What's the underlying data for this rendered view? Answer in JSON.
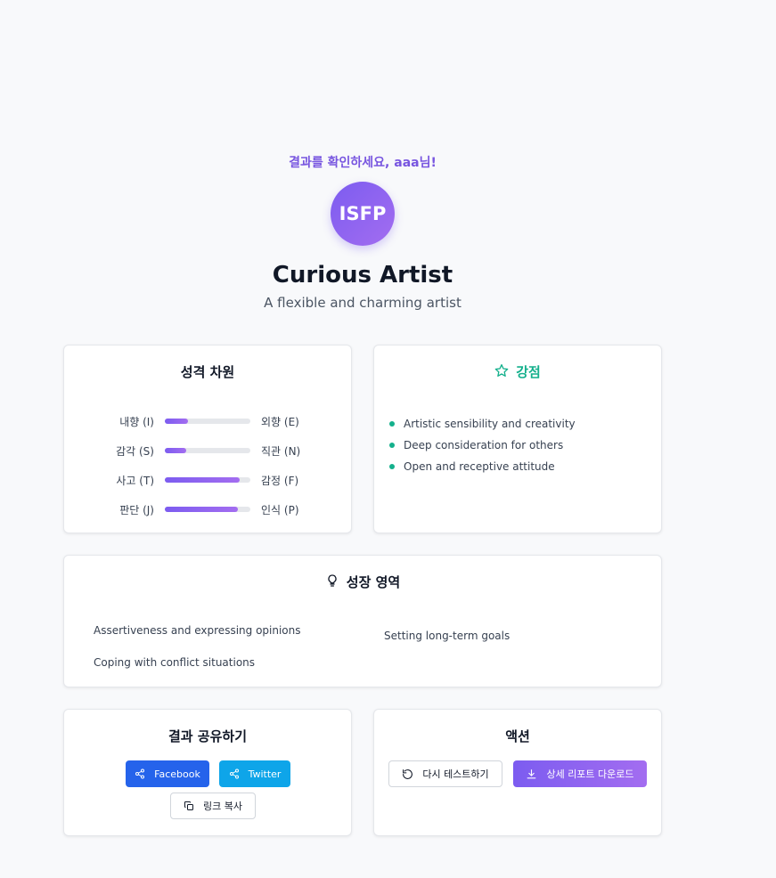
{
  "header": {
    "greeting": "결과를 확인하세요, aaa님!",
    "type_code": "ISFP",
    "type_name": "Curious Artist",
    "tagline": "A flexible and charming artist"
  },
  "dimensions": {
    "title": "성격 차원",
    "rows": [
      {
        "left": "내향 (I)",
        "right": "외향 (E)",
        "value": 0.27
      },
      {
        "left": "감각 (S)",
        "right": "직관 (N)",
        "value": 0.25
      },
      {
        "left": "사고 (T)",
        "right": "감정 (F)",
        "value": 0.87
      },
      {
        "left": "판단 (J)",
        "right": "인식 (P)",
        "value": 0.85
      }
    ]
  },
  "strengths": {
    "title": "강점",
    "icon": "star-icon",
    "items": [
      "Artistic sensibility and creativity",
      "Deep consideration for others",
      "Open and receptive attitude"
    ]
  },
  "growth": {
    "title": "성장 영역",
    "icon": "lightbulb-icon",
    "items": [
      "Assertiveness and expressing opinions",
      "Setting long-term goals",
      "Coping with conflict situations"
    ]
  },
  "share": {
    "title": "결과 공유하기",
    "facebook_label": "Facebook",
    "twitter_label": "Twitter",
    "copy_label": "링크 복사"
  },
  "actions": {
    "title": "액션",
    "retake_label": "다시 테스트하기",
    "download_label": "상세 리포트 다운로드"
  },
  "colors": {
    "accent": "#7c5cf0",
    "strength": "#14b08c",
    "facebook": "#2563eb",
    "twitter": "#0ea5e9"
  }
}
